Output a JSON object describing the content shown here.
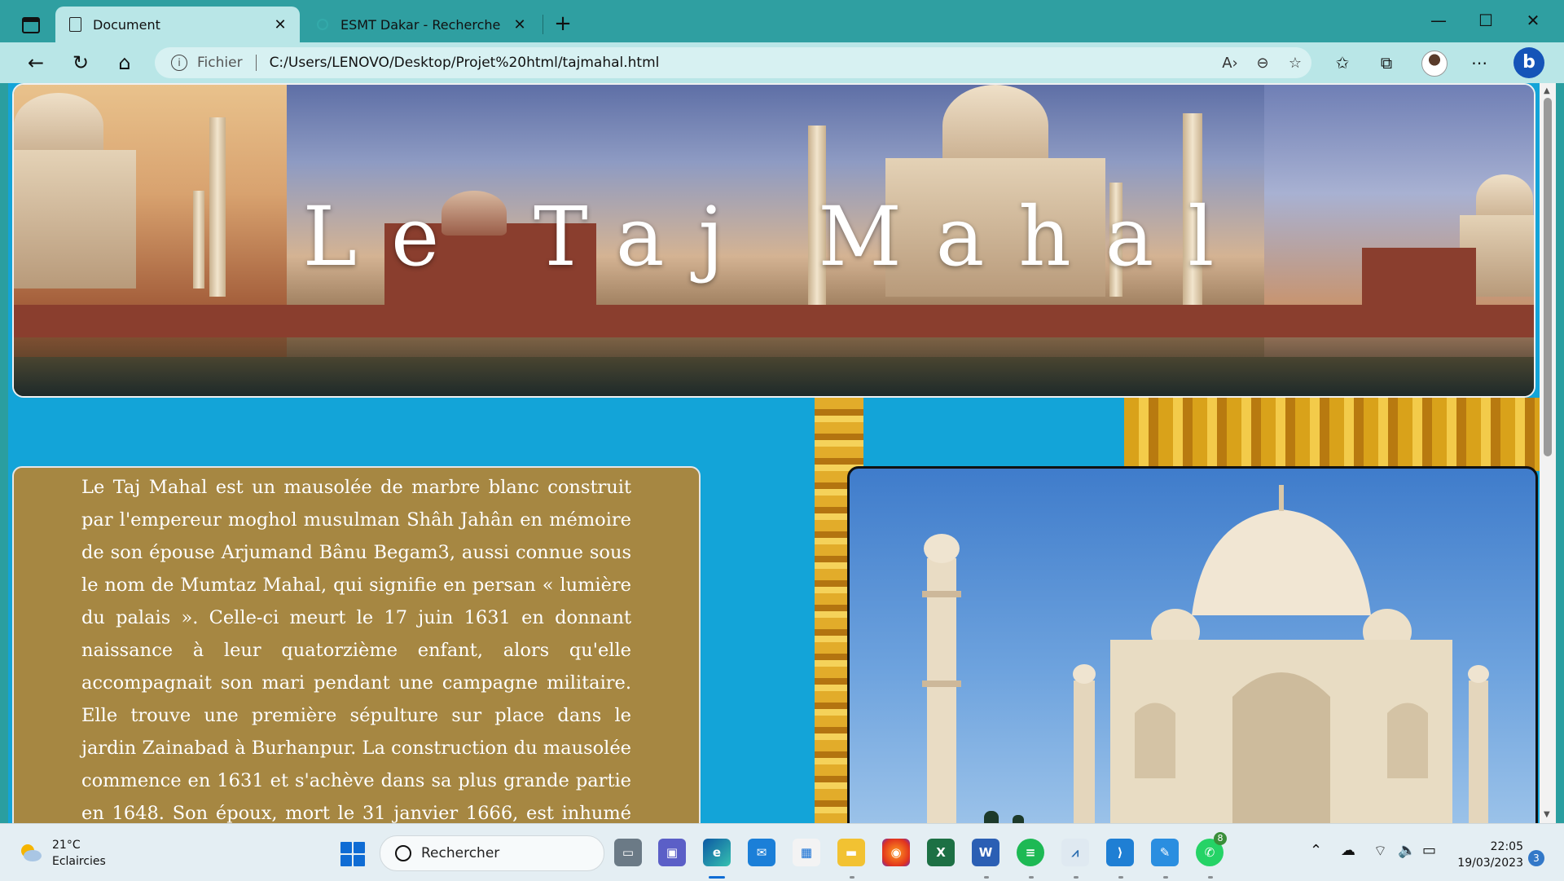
{
  "browser": {
    "tabs": [
      {
        "label": "Document",
        "icon": "document-icon",
        "active": true
      },
      {
        "label": "ESMT Dakar - Recherche",
        "icon": "search-icon",
        "active": false
      }
    ],
    "address": {
      "scheme_label": "Fichier",
      "url": "C:/Users/LENOVO/Desktop/Projet%20html/tajmahal.html"
    }
  },
  "page": {
    "banner_title": "Le Taj Mahal",
    "paragraph": "Le Taj Mahal est un mausolée de marbre blanc construit par l'empereur moghol musulman Shâh Jahân en mémoire de son épouse Arjumand Bânu Begam3, aussi connue sous le nom de Mumtaz Mahal, qui signifie en persan « lumière du palais ». Celle-ci meurt le 17 juin 1631 en donnant naissance à leur quatorzième enfant, alors qu'elle accompagnait son mari pendant une campagne militaire. Elle trouve une première sépulture sur place dans le jardin Zainabad à Burhanpur. La construction du mausolée commence en 1631 et s'achève dans sa plus grande partie en 1648. Son époux, mort le 31 janvier 1666, est inhumé auprès d'elle. Le Taj Mahal est considéré comme un"
  },
  "taskbar": {
    "weather": {
      "temp": "21°C",
      "desc": "Eclaircies"
    },
    "search_placeholder": "Rechercher",
    "apps": [
      "task-view",
      "teams-chat",
      "edge",
      "mail",
      "store",
      "file-explorer",
      "firefox",
      "excel",
      "word",
      "spotify",
      "perf-monitor",
      "vscode",
      "paint",
      "whatsapp"
    ],
    "whatsapp_badge": "8",
    "clock": {
      "time": "22:05",
      "date": "19/03/2023"
    },
    "notifications": "3"
  },
  "colors": {
    "accent": "#2f9fa1",
    "page_bg": "#13a4d8",
    "panel": "#a9873e"
  }
}
